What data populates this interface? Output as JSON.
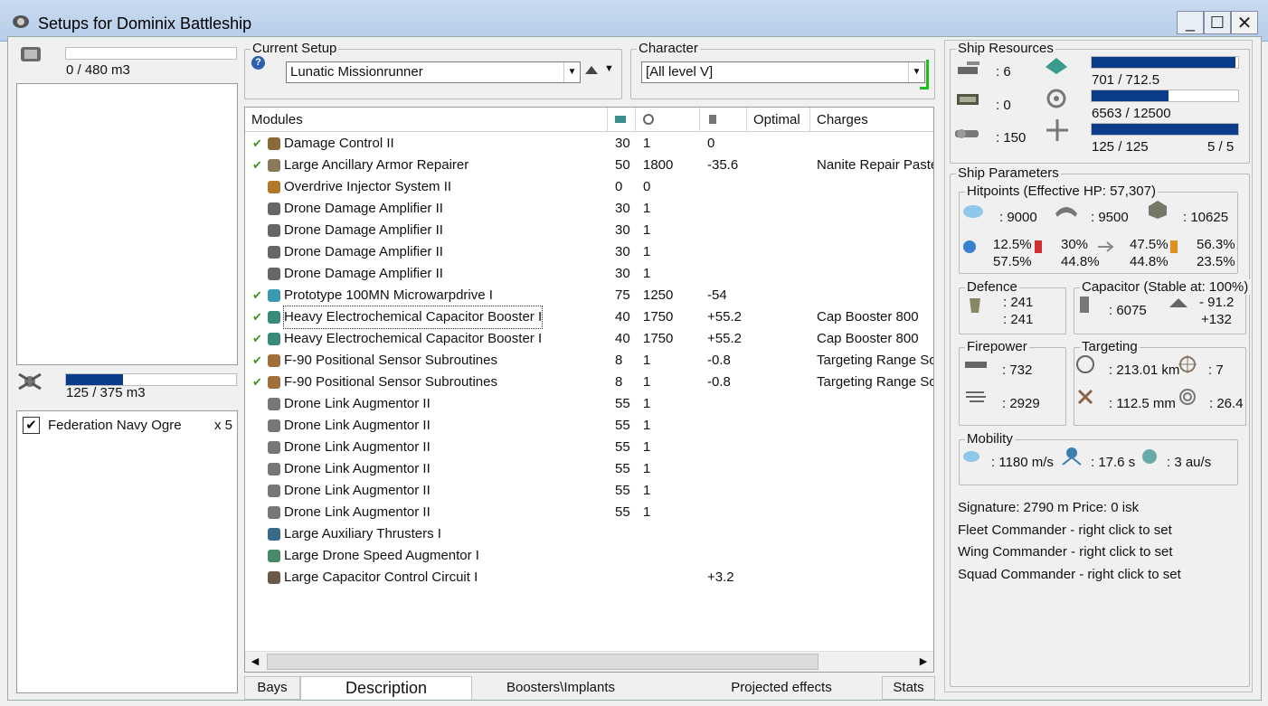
{
  "window": {
    "title": "Setups for Dominix Battleship",
    "minimize": "_",
    "maximize": "☐",
    "close": "✕"
  },
  "cargo": {
    "value": "0 / 480 m3",
    "fill": 0.0
  },
  "dronebay": {
    "value": "125 / 375 m3",
    "fill": 0.333,
    "drones": [
      {
        "name": "Federation Navy Ogre",
        "qty": "x 5",
        "checked": true
      }
    ]
  },
  "current_setup": {
    "label": "Current Setup",
    "help_icon": "?",
    "value": "Lunatic Missionrunner"
  },
  "character": {
    "label": "Character",
    "value": "[All level V]"
  },
  "modules_table": {
    "headers": {
      "modules": "Modules",
      "optimal": "Optimal",
      "charges": "Charges"
    },
    "rows": [
      {
        "check": "✔",
        "icon": "damage-control-icon",
        "name": "Damage Control II",
        "cpu": "30",
        "pg": "1",
        "cap": "0",
        "charge": ""
      },
      {
        "check": "✔",
        "icon": "armor-repairer-icon",
        "name": "Large Ancillary Armor Repairer",
        "cpu": "50",
        "pg": "1800",
        "cap": "-35.6",
        "charge": "Nanite Repair Paste"
      },
      {
        "check": "",
        "icon": "overdrive-icon",
        "name": "Overdrive Injector System II",
        "cpu": "0",
        "pg": "0",
        "cap": "",
        "charge": ""
      },
      {
        "check": "",
        "icon": "drone-damage-icon",
        "name": "Drone Damage Amplifier II",
        "cpu": "30",
        "pg": "1",
        "cap": "",
        "charge": ""
      },
      {
        "check": "",
        "icon": "drone-damage-icon",
        "name": "Drone Damage Amplifier II",
        "cpu": "30",
        "pg": "1",
        "cap": "",
        "charge": ""
      },
      {
        "check": "",
        "icon": "drone-damage-icon",
        "name": "Drone Damage Amplifier II",
        "cpu": "30",
        "pg": "1",
        "cap": "",
        "charge": ""
      },
      {
        "check": "",
        "icon": "drone-damage-icon",
        "name": "Drone Damage Amplifier II",
        "cpu": "30",
        "pg": "1",
        "cap": "",
        "charge": ""
      },
      {
        "check": "✔",
        "icon": "microwarpdrive-icon",
        "name": "Prototype 100MN Microwarpdrive I",
        "cpu": "75",
        "pg": "1250",
        "cap": "-54",
        "charge": ""
      },
      {
        "check": "✔",
        "icon": "cap-booster-icon",
        "name": "Heavy Electrochemical Capacitor Booster I",
        "cpu": "40",
        "pg": "1750",
        "cap": "+55.2",
        "charge": "Cap Booster 800",
        "selected": true
      },
      {
        "check": "✔",
        "icon": "cap-booster-icon",
        "name": "Heavy Electrochemical Capacitor Booster I",
        "cpu": "40",
        "pg": "1750",
        "cap": "+55.2",
        "charge": "Cap Booster 800"
      },
      {
        "check": "✔",
        "icon": "sensor-subroutines-icon",
        "name": "F-90 Positional Sensor Subroutines",
        "cpu": "8",
        "pg": "1",
        "cap": "-0.8",
        "charge": "Targeting Range Script"
      },
      {
        "check": "✔",
        "icon": "sensor-subroutines-icon",
        "name": "F-90 Positional Sensor Subroutines",
        "cpu": "8",
        "pg": "1",
        "cap": "-0.8",
        "charge": "Targeting Range Script"
      },
      {
        "check": "",
        "icon": "drone-link-icon",
        "name": "Drone Link Augmentor II",
        "cpu": "55",
        "pg": "1",
        "cap": "",
        "charge": ""
      },
      {
        "check": "",
        "icon": "drone-link-icon",
        "name": "Drone Link Augmentor II",
        "cpu": "55",
        "pg": "1",
        "cap": "",
        "charge": ""
      },
      {
        "check": "",
        "icon": "drone-link-icon",
        "name": "Drone Link Augmentor II",
        "cpu": "55",
        "pg": "1",
        "cap": "",
        "charge": ""
      },
      {
        "check": "",
        "icon": "drone-link-icon",
        "name": "Drone Link Augmentor II",
        "cpu": "55",
        "pg": "1",
        "cap": "",
        "charge": ""
      },
      {
        "check": "",
        "icon": "drone-link-icon",
        "name": "Drone Link Augmentor II",
        "cpu": "55",
        "pg": "1",
        "cap": "",
        "charge": ""
      },
      {
        "check": "",
        "icon": "drone-link-icon",
        "name": "Drone Link Augmentor II",
        "cpu": "55",
        "pg": "1",
        "cap": "",
        "charge": ""
      },
      {
        "check": "",
        "icon": "rig-thrusters-icon",
        "name": "Large Auxiliary Thrusters I",
        "cpu": "",
        "pg": "",
        "cap": "",
        "charge": ""
      },
      {
        "check": "",
        "icon": "rig-drone-speed-icon",
        "name": "Large Drone Speed Augmentor I",
        "cpu": "",
        "pg": "",
        "cap": "",
        "charge": ""
      },
      {
        "check": "",
        "icon": "rig-capacitor-icon",
        "name": "Large Capacitor Control Circuit I",
        "cpu": "",
        "pg": "",
        "cap": "+3.2",
        "charge": ""
      }
    ]
  },
  "tabs": [
    "Bays",
    "Description",
    "Boosters\\Implants",
    "Projected effects",
    "Stats"
  ],
  "ship_resources": {
    "label": "Ship Resources",
    "turrets": ": 6",
    "launchers": ": 0",
    "calibration": ": 150",
    "cpu": {
      "value": "701 / 712.5",
      "fill": 0.984
    },
    "powergrid": {
      "value": "6563 / 12500",
      "fill": 0.525
    },
    "drone_bandwidth": {
      "value": "125 / 125",
      "fill": 1.0
    },
    "drones_active": "5 / 5"
  },
  "ship_parameters": {
    "label": "Ship Parameters",
    "hitpoints": {
      "label": "Hitpoints (Effective HP: 57,307)",
      "shield": ": 9000",
      "armor": ": 9500",
      "structure": ": 10625",
      "resists": {
        "em": [
          "12.5%",
          "57.5%"
        ],
        "thermal": [
          "30%",
          "44.8%"
        ],
        "kinetic": [
          "47.5%",
          "44.8%"
        ],
        "explosive": [
          "56.3%",
          "23.5%"
        ]
      }
    },
    "defence": {
      "label": "Defence",
      "v1": ": 241",
      "v2": ": 241"
    },
    "capacitor": {
      "label": "Capacitor (Stable at: 100%)",
      "capacity": ": 6075",
      "v1": "- 91.2",
      "v2": "+132"
    },
    "firepower": {
      "label": "Firepower",
      "weapon": ": 732",
      "drones": ": 2929"
    },
    "targeting": {
      "label": "Targeting",
      "range": ": 213.01 km",
      "targets": ": 7",
      "scan": ": 112.5 mm",
      "sensor": ": 26.4"
    },
    "mobility": {
      "label": "Mobility",
      "speed": ": 1180 m/s",
      "align": ": 17.6 s",
      "warp": ": 3 au/s"
    }
  },
  "summary": {
    "signature": "Signature: 2790 m  Price: 0 isk",
    "fleet": "Fleet Commander - right click to set",
    "wing": "Wing Commander - right click to set",
    "squad": "Squad Commander - right click to set"
  }
}
